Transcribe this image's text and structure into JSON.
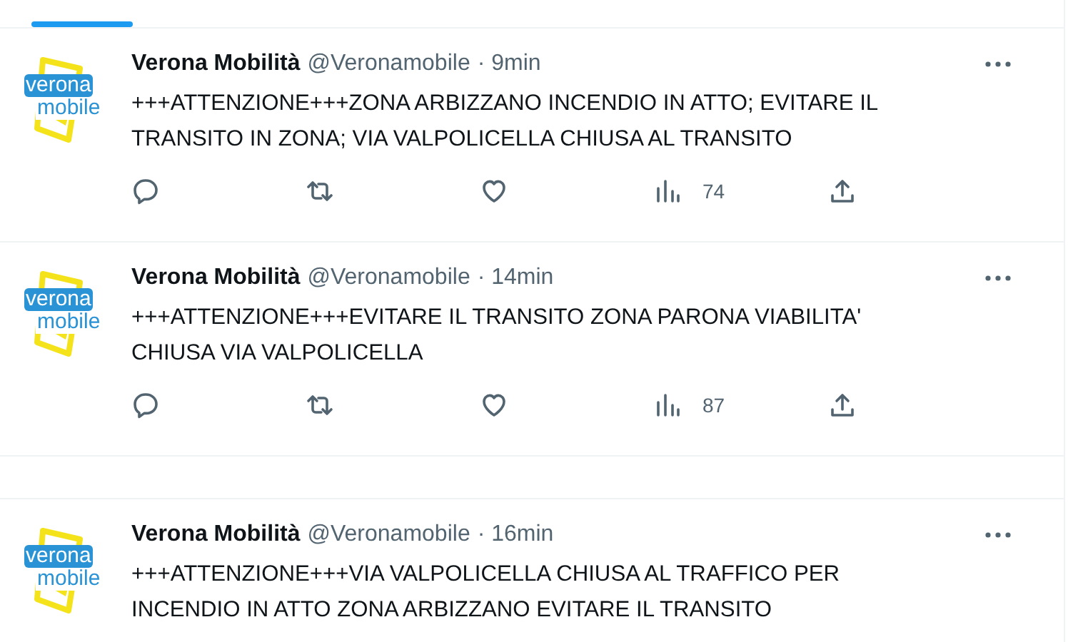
{
  "tabs": [
    {
      "selected": true
    }
  ],
  "tweets": [
    {
      "avatar": [
        "verona",
        "mobile"
      ],
      "name": "Verona Mobilità",
      "handle": "@Veronamobile",
      "time": "· 9min",
      "text_lines": [
        "+++ATTENZIONE+++ZONA ARBIZZANO INCENDIO IN ATTO; EVITARE IL",
        "TRANSITO IN ZONA; VIA VALPOLICELLA CHIUSA AL TRANSITO"
      ],
      "views": "74",
      "kind": "tweet"
    },
    {
      "avatar": [
        "verona",
        "mobile"
      ],
      "name": "Verona Mobilità",
      "handle": "@Veronamobile",
      "time": "· 14min",
      "text_lines": [
        "+++ATTENZIONE+++EVITARE IL TRANSITO ZONA PARONA VIABILITA'",
        "CHIUSA VIA VALPOLICELLA"
      ],
      "views": "87",
      "kind": "tweet"
    },
    {
      "kind": "gap"
    },
    {
      "avatar": [
        "verona",
        "mobile"
      ],
      "name": "Verona Mobilità",
      "handle": "@Veronamobile",
      "time": "· 16min",
      "text_lines": [
        "+++ATTENZIONE+++VIA VALPOLICELLA CHIUSA AL TRAFFICO PER",
        "INCENDIO IN ATTO ZONA ARBIZZANO EVITARE IL TRANSITO"
      ],
      "kind": "tweet"
    }
  ]
}
